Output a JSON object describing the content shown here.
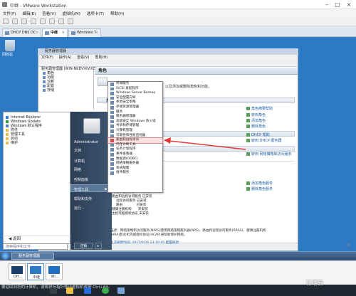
{
  "window": {
    "title": "中继 - VMware Workstation"
  },
  "menubar": [
    "文件(F)",
    "编辑(E)",
    "查看(V)",
    "虚拟机(M)",
    "选项卡(T)",
    "帮助(H)"
  ],
  "tabs": [
    {
      "label": "DHCP DNS DC",
      "active": false
    },
    {
      "label": "中继",
      "active": true
    },
    {
      "label": "Windows 7",
      "active": false
    }
  ],
  "desktop": {
    "recycle_bin": "回收站"
  },
  "server_manager": {
    "title": "服务器管理器",
    "menu": [
      "文件(F)",
      "操作(A)",
      "查看(V)",
      "帮助(H)"
    ],
    "tree": [
      {
        "label": "服务器管理器 (WIN-NKDVXIVIX3)",
        "level": 0
      },
      {
        "label": "角色",
        "level": 1
      },
      {
        "label": "功能",
        "level": 1
      },
      {
        "label": "诊断",
        "level": 1
      },
      {
        "label": "配置",
        "level": 1
      },
      {
        "label": "存储",
        "level": 1
      }
    ],
    "roles_header": "角色",
    "roles_intro": "以及添加或删除角色和功能。",
    "sections": [
      {
        "title": "角色摘要",
        "links": [
          "转到角色",
          "添加角色",
          "删除角色"
        ],
        "side": "角色摘要帮助"
      },
      {
        "title": "DHCP 服务器",
        "links": [
          "转到 DHCP 服务器"
        ],
        "side": "DHCP 帮助"
      },
      {
        "title": "网络策略和访问服务",
        "links": [
          "转到 网络策略和访问服务"
        ],
        "side": ""
      },
      {
        "title": "",
        "links": [
          "添加角色服务",
          "删除角色服务"
        ],
        "side": ""
      }
    ],
    "services": [
      [
        "网络策略服务器",
        "未安装"
      ],
      [
        "路由和远程访问服务",
        "已安装"
      ],
      [
        "远程访问服务",
        "已安装"
      ],
      [
        "路由",
        "已安装"
      ],
      [
        "健康注册机构",
        "未安装"
      ],
      [
        "主机凭据授权协议",
        "未安装"
      ]
    ],
    "description": "描述：网络策略和访问服务(NPAS)使用网络策略服务器(NPS)、路由和远程访问服务(RRAS)、健康注册机构(HRA)和主机凭据授权协议(HCAP)来帮助保护网络。",
    "last_refresh": "上次刷新时间: 2017/6/26 23:10:45  配置刷新"
  },
  "start_menu": {
    "programs": [
      "Internet Explorer",
      "Windows Update",
      "Windows 默认程序",
      "附件",
      "管理工具",
      "启动",
      "维护"
    ],
    "back": "返回",
    "search_placeholder": "搜索程序和文件",
    "user": "Administrator",
    "right_items": [
      "文档",
      "计算机",
      "网络",
      "控制面板",
      "管理工具",
      "帮助和支持",
      "运行..."
    ],
    "shutdown": "注销"
  },
  "admin_tools_submenu": [
    "终端服务",
    "iSCSI 发起程序",
    "Windows Server Backup",
    "安全配置向导",
    "本地安全策略",
    "存储资源管理器",
    "服务",
    "服务器管理器",
    "高级安全 Windows 防火墙",
    "共享和存储管理",
    "计算机管理",
    "可靠性和性能监视器",
    "路由和远程访问",
    "内存诊断工具",
    "任务计划程序",
    "事件查看器",
    "数据源(ODBC)",
    "网络策略服务器",
    "系统配置",
    "组件服务"
  ],
  "highlighted_submenu_item": "路由和远程访问",
  "taskbar": {
    "start_item": "服务器管理器"
  },
  "vm_thumbnails": [
    "DH...",
    "中继",
    "Wi..."
  ],
  "host_status": "要返回到您的计算机，请将鼠标指针移出虚拟机或按 Ctrl+Alt。",
  "watermark": "亿速云",
  "colors": {
    "desktop": "#2e79c3",
    "highlight": "#e03a3a",
    "link": "#1f5fa8"
  }
}
